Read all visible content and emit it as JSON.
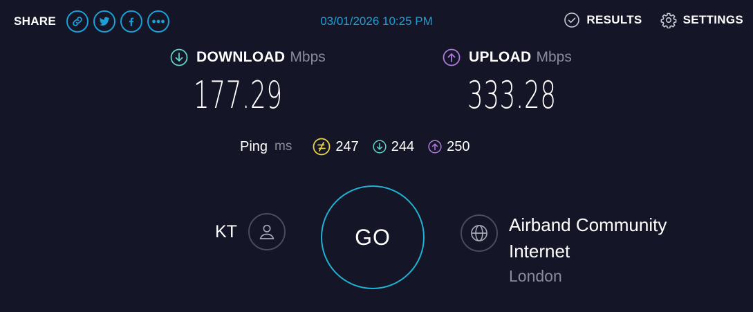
{
  "header": {
    "share_label": "SHARE",
    "datetime": "03/01/2026 10:25 PM",
    "results_label": "RESULTS",
    "settings_label": "SETTINGS"
  },
  "download": {
    "title": "DOWNLOAD",
    "unit": "Mbps",
    "value": "177.29"
  },
  "upload": {
    "title": "UPLOAD",
    "unit": "Mbps",
    "value": "333.28"
  },
  "ping": {
    "label": "Ping",
    "unit": "ms",
    "idle": "247",
    "download": "244",
    "upload": "250"
  },
  "user": {
    "initials": "KT"
  },
  "go_label": "GO",
  "server": {
    "name": "Airband Community Internet",
    "location": "London"
  },
  "colors": {
    "background": "#141526",
    "accent": "#1aa0d8",
    "download": "#5fd3c8",
    "upload": "#b07bdc",
    "idle": "#e8d34a",
    "go_ring": "#1eb3d4"
  },
  "icons": {
    "share": [
      "link-icon",
      "twitter-icon",
      "facebook-icon",
      "more-icon"
    ],
    "results": "check-circle-icon",
    "settings": "gear-icon",
    "user": "person-icon",
    "server": "globe-icon"
  }
}
